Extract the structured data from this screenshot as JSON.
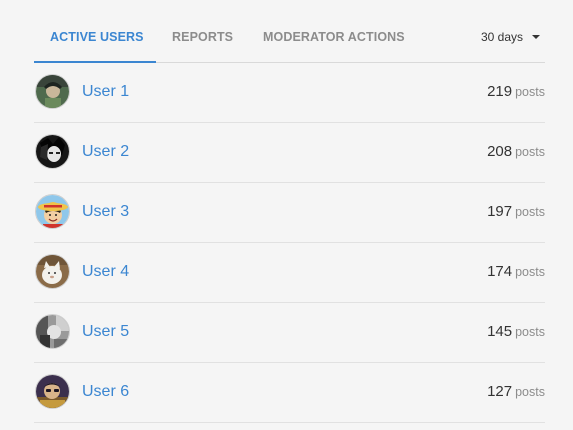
{
  "tabs": [
    {
      "label": "ACTIVE USERS",
      "active": true
    },
    {
      "label": "REPORTS",
      "active": false
    },
    {
      "label": "MODERATOR ACTIONS",
      "active": false
    }
  ],
  "range_selector": {
    "value": "30 days",
    "icon": "caret-down-icon"
  },
  "accent_color": "#3b86d1",
  "users": [
    {
      "name": "User 1",
      "count": "219",
      "unit": "posts",
      "avatar": "avatar-dark-green-character"
    },
    {
      "name": "User 2",
      "count": "208",
      "unit": "posts",
      "avatar": "avatar-black-white-character"
    },
    {
      "name": "User 3",
      "count": "197",
      "unit": "posts",
      "avatar": "avatar-straw-hat-character"
    },
    {
      "name": "User 4",
      "count": "174",
      "unit": "posts",
      "avatar": "avatar-white-animal-on-brown"
    },
    {
      "name": "User 5",
      "count": "145",
      "unit": "posts",
      "avatar": "avatar-grey-monochrome-scene"
    },
    {
      "name": "User 6",
      "count": "127",
      "unit": "posts",
      "avatar": "avatar-purple-gold-character"
    }
  ]
}
